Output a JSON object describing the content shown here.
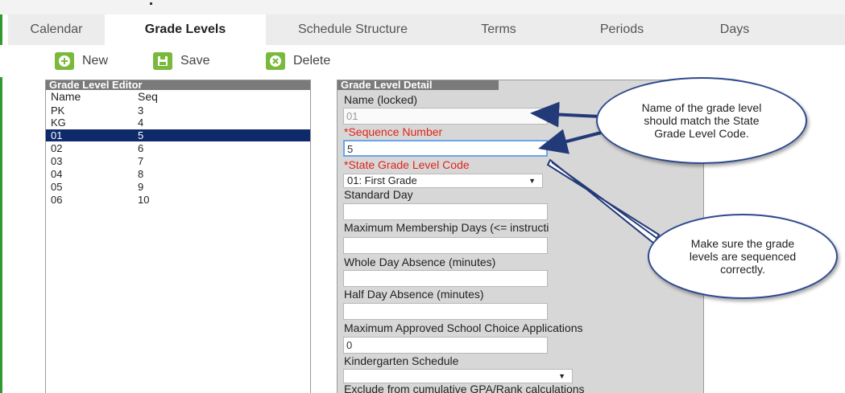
{
  "tabs": [
    {
      "label": "Calendar"
    },
    {
      "label": "Grade Levels"
    },
    {
      "label": "Schedule Structure"
    },
    {
      "label": "Terms"
    },
    {
      "label": "Periods"
    },
    {
      "label": "Days"
    }
  ],
  "active_tab": "Grade Levels",
  "toolbar": {
    "new_label": "New",
    "save_label": "Save",
    "delete_label": "Delete",
    "new_icon": "plus-circle-icon",
    "save_icon": "floppy-disk-icon",
    "delete_icon": "x-circle-icon"
  },
  "editor": {
    "title": "Grade Level Editor",
    "col_name": "Name",
    "col_seq": "Seq",
    "rows": [
      {
        "name": "PK",
        "seq": "3"
      },
      {
        "name": "KG",
        "seq": "4"
      },
      {
        "name": "01",
        "seq": "5"
      },
      {
        "name": "02",
        "seq": "6"
      },
      {
        "name": "03",
        "seq": "7"
      },
      {
        "name": "04",
        "seq": "8"
      },
      {
        "name": "05",
        "seq": "9"
      },
      {
        "name": "06",
        "seq": "10"
      }
    ],
    "selected_name": "01"
  },
  "detail": {
    "title": "Grade Level Detail",
    "name_label": "Name (locked)",
    "name_value": "01",
    "seq_label": "*Sequence Number",
    "seq_value": "5",
    "state_label": "*State Grade Level Code",
    "state_value": "01: First Grade",
    "standard_day_label": "Standard Day",
    "standard_day_value": "",
    "max_membership_label": "Maximum Membership Days (<= instructi",
    "max_membership_value": "",
    "whole_day_label": "Whole Day Absence (minutes)",
    "whole_day_value": "",
    "half_day_label": "Half Day Absence (minutes)",
    "half_day_value": "",
    "max_choice_label": "Maximum Approved School Choice Applications",
    "max_choice_value": "0",
    "kindergarten_label": "Kindergarten Schedule",
    "kindergarten_value": "",
    "exclude_label": "Exclude from cumulative GPA/Rank calculations"
  },
  "callouts": {
    "top": "Name of the grade level should match the State Grade Level Code.",
    "bottom": "Make sure the grade levels are sequenced correctly."
  },
  "colors": {
    "accent_green": "#79b93c",
    "selected_row": "#0f2a6b",
    "required_label": "#e0241b",
    "callout_border": "#2f4a8f"
  }
}
